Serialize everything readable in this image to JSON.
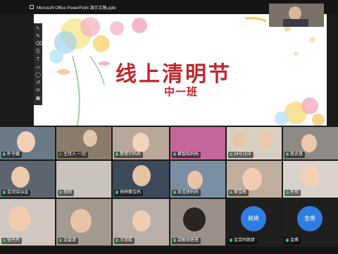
{
  "window": {
    "title": "Microsoft Office PowerPoint 演示文稿.pptx"
  },
  "slide": {
    "title": "线上清明节",
    "subtitle": "中一班"
  },
  "toolbar": {
    "tools": [
      "↖",
      "✎",
      "⌫",
      "⎘",
      "T",
      "▭",
      "◯",
      "↺",
      "⟳",
      "▣"
    ]
  },
  "participants": [
    {
      "name": "朴令媛",
      "role": ""
    },
    {
      "name": "主持人",
      "role": "host"
    },
    {
      "name": "一切",
      "role": ""
    },
    {
      "name": "詹倩宇妈妈",
      "role": ""
    },
    {
      "name": "崔智晗妈妈",
      "role": ""
    },
    {
      "name": "24号汪洋",
      "role": ""
    },
    {
      "name": "南贞恩",
      "role": ""
    },
    {
      "name": "金沏泪😘金",
      "role": ""
    },
    {
      "name": "杨帅",
      "role": ""
    },
    {
      "name": "俏神赛宝妈",
      "role": ""
    },
    {
      "name": "吴佳妍妈妈",
      "role": ""
    },
    {
      "name": "崔雪梅",
      "role": ""
    },
    {
      "name": "朴然",
      "role": ""
    },
    {
      "name": "徐丹丹",
      "role": ""
    },
    {
      "name": "金姿淑",
      "role": ""
    },
    {
      "name": "王琅皓",
      "role": ""
    },
    {
      "name": "梁敏硕爸爸",
      "role": ""
    },
    {
      "name": "金芙阿姥姥",
      "role": ""
    },
    {
      "name": "金燕",
      "role": ""
    }
  ],
  "avatars": [
    "姥姥",
    "金燕"
  ],
  "colors": {
    "slide_title": "#c0262e",
    "avatar": "#2f7de0",
    "background": "#1b1b1b"
  }
}
